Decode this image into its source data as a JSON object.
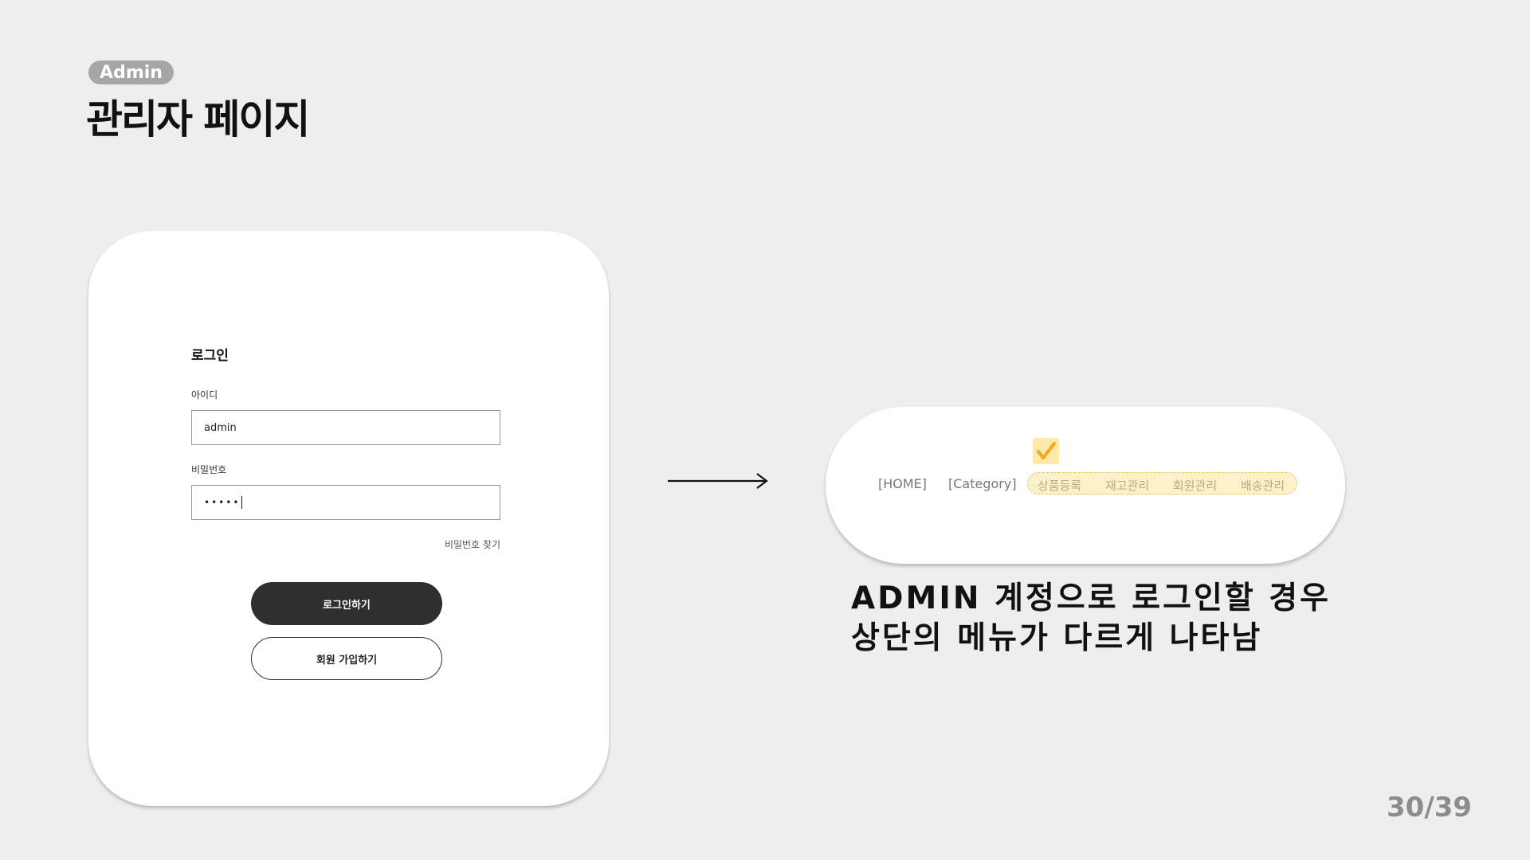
{
  "header": {
    "badge": "Admin",
    "title": "관리자 페이지"
  },
  "login": {
    "title": "로그인",
    "id_label": "아이디",
    "id_value": "admin",
    "pw_label": "비밀번호",
    "pw_value": "•••••",
    "find_pw": "비밀번호 찾기",
    "login_button": "로그인하기",
    "signup_button": "회원 가입하기"
  },
  "nav": {
    "home": "[HOME]",
    "category": "[Category]",
    "admin_items": [
      "상품등록",
      "재고관리",
      "회원관리",
      "배송관리"
    ],
    "check_icon": "checkmark-icon",
    "highlight_color": "#fdf1c9",
    "check_color": "#f5a623"
  },
  "description": {
    "line1": "ADMIN 계정으로 로그인할 경우",
    "line2": "상단의 메뉴가 다르게 나타남"
  },
  "page_number": "30/39"
}
